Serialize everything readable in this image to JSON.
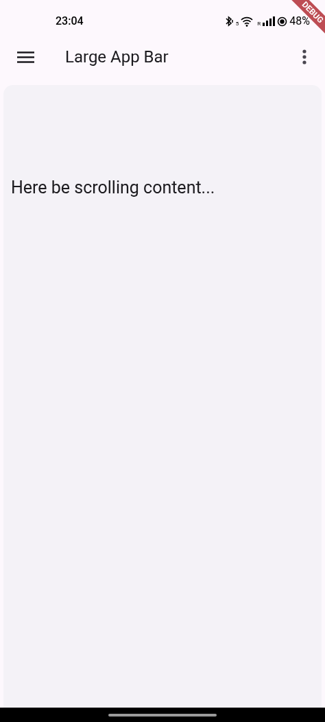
{
  "status_bar": {
    "time": "23:04",
    "wifi_badge": "5",
    "signal_badge": "R",
    "battery": "48%"
  },
  "app_bar": {
    "title": "Large App Bar"
  },
  "content": {
    "text": "Here be scrolling content..."
  },
  "debug_banner": {
    "label": "DEBUG"
  }
}
